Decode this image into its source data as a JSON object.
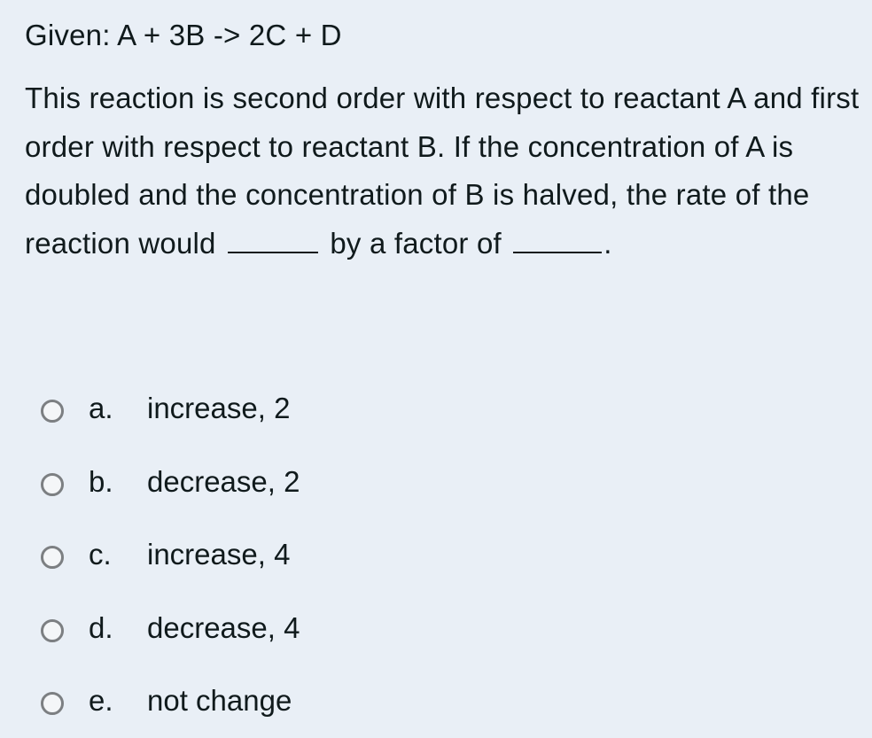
{
  "question": {
    "given": "Given: A + 3B -> 2C + D",
    "text_part1": "This reaction is second order with respect to reactant A and first order with respect to reactant B. If the concentration of A is doubled and the concentration of B is halved, the rate of the reaction would",
    "text_part2": "by a factor of",
    "text_part3": "."
  },
  "options": [
    {
      "letter": "a.",
      "text": "increase, 2"
    },
    {
      "letter": "b.",
      "text": "decrease, 2"
    },
    {
      "letter": "c.",
      "text": "increase, 4"
    },
    {
      "letter": "d.",
      "text": "decrease, 4"
    },
    {
      "letter": "e.",
      "text": "not change"
    }
  ]
}
